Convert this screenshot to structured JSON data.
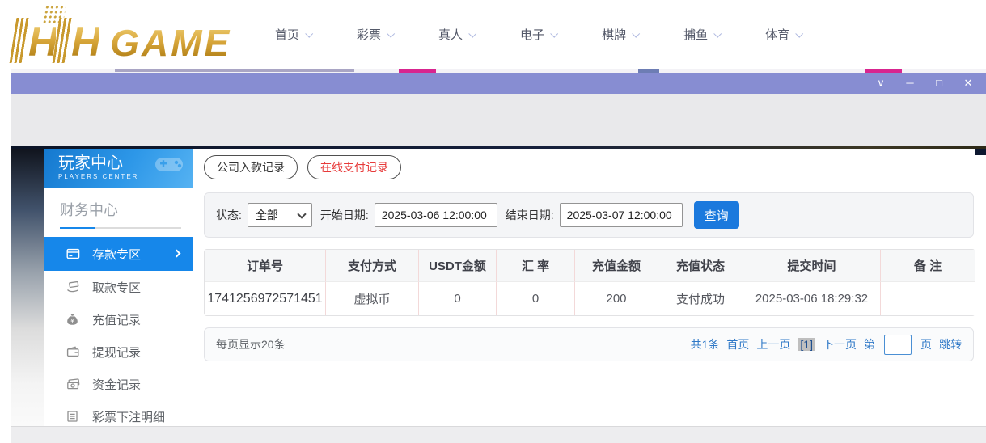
{
  "logo": {
    "h1": "H",
    "h2": "H",
    "game": "GAME"
  },
  "nav": {
    "items": [
      {
        "label": "首页"
      },
      {
        "label": "彩票"
      },
      {
        "label": "真人"
      },
      {
        "label": "电子"
      },
      {
        "label": "棋牌"
      },
      {
        "label": "捕鱼"
      },
      {
        "label": "体育"
      }
    ]
  },
  "window": {
    "controls": {
      "dropdown": "∨",
      "minimize": "─",
      "maximize": "□",
      "close": "✕"
    }
  },
  "sidebar": {
    "title": "玩家中心",
    "subtitle": "PLAYERS CENTER",
    "section": "财务中心",
    "items": [
      {
        "label": "存款专区",
        "active": true
      },
      {
        "label": "取款专区"
      },
      {
        "label": "充值记录"
      },
      {
        "label": "提现记录"
      },
      {
        "label": "资金记录"
      },
      {
        "label": "彩票下注明细"
      }
    ]
  },
  "tabs": [
    {
      "label": "公司入款记录",
      "active": false
    },
    {
      "label": "在线支付记录",
      "active": true
    }
  ],
  "filters": {
    "status_label": "状态:",
    "status_value": "全部",
    "start_label": "开始日期:",
    "start_value": "2025-03-06 12:00:00",
    "end_label": "结束日期:",
    "end_value": "2025-03-07 12:00:00",
    "search_button": "查询"
  },
  "table": {
    "headers": [
      "订单号",
      "支付方式",
      "USDT金额",
      "汇 率",
      "充值金额",
      "充值状态",
      "提交时间",
      "备 注"
    ],
    "rows": [
      [
        "1741256972571451",
        "虚拟币",
        "0",
        "0",
        "200",
        "支付成功",
        "2025-03-06 18:29:32",
        ""
      ]
    ]
  },
  "pagination": {
    "page_size_text": "每页显示20条",
    "total_text": "共1条",
    "first": "首页",
    "prev": "上一页",
    "current": "[1]",
    "next": "下一页",
    "jump_prefix": "第",
    "jump_suffix": "页",
    "jump_button": "跳转",
    "jump_value": ""
  },
  "colors": {
    "accent_blue": "#1687ea",
    "button_blue": "#1b79dd",
    "titlebar_purple": "#878dd2",
    "tab_active_red": "#e73b3b",
    "logo_gold": "#d9a83c",
    "pagination_blue": "#2e78c7"
  }
}
